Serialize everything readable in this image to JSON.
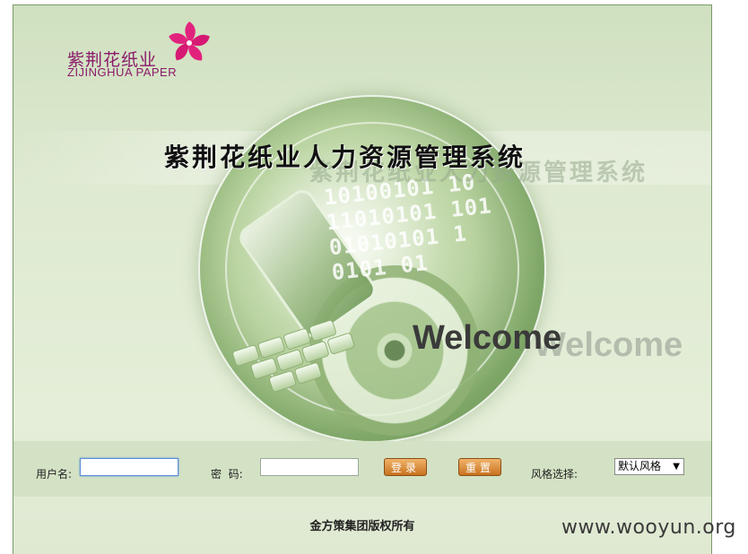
{
  "logo": {
    "cn": "紫荆花纸业",
    "en": "ZIJINGHUA PAPER"
  },
  "title": "紫荆花纸业人力资源管理系统",
  "welcome": "Welcome",
  "binary_lines": [
    "10100101 10",
    "11010101 101",
    "01010101 1",
    "0101 01"
  ],
  "login": {
    "username_label": "用户名:",
    "username_value": "",
    "password_label": "密  码:",
    "password_value": "",
    "login_button": "登录",
    "reset_button": "重置",
    "style_label": "风格选择:",
    "style_selected": "默认风格"
  },
  "footer": {
    "copyright": "金方策集团版权所有"
  },
  "watermark": "www.wooyun.org"
}
